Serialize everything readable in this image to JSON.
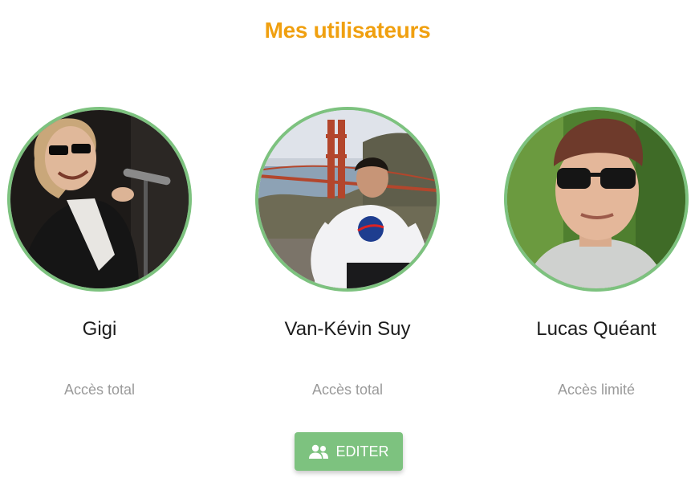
{
  "page": {
    "title": "Mes utilisateurs",
    "title_color": "#f0a010",
    "accent_color": "#7dc27f"
  },
  "users": [
    {
      "name": "Gigi",
      "access": "Accès total",
      "avatar_icon": "user-photo"
    },
    {
      "name": "Van-Kévin Suy",
      "access": "Accès total",
      "avatar_icon": "user-photo"
    },
    {
      "name": "Lucas Quéant",
      "access": "Accès limité",
      "avatar_icon": "user-photo"
    }
  ],
  "edit_button": {
    "label": "EDITER",
    "icon": "users-icon",
    "background": "#7dc27f"
  }
}
